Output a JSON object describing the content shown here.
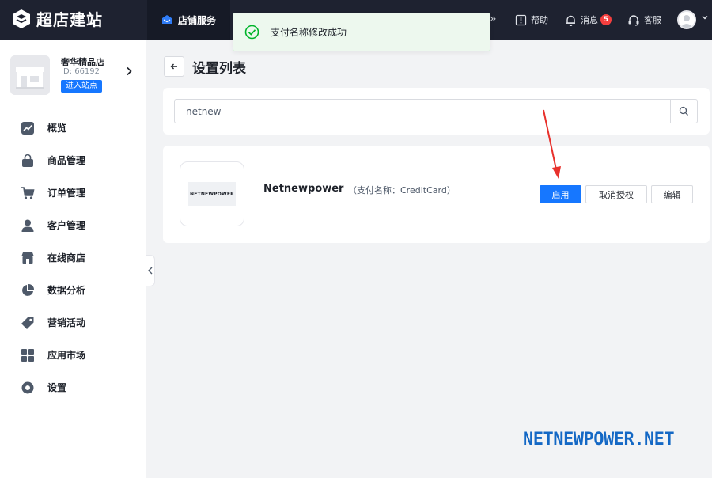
{
  "brand": {
    "name": "超店建站"
  },
  "topbar": {
    "active_label": "店铺服务",
    "more_glyph": "»",
    "help_label": "帮助",
    "messages_label": "消息",
    "messages_count": "5",
    "service_label": "客服"
  },
  "toast": {
    "message": "支付名称修改成功",
    "status_color": "#00b42a"
  },
  "store": {
    "name": "奢华精品店",
    "id_label": "ID: 66192",
    "enter_label": "进入站点"
  },
  "sidebar": {
    "items": [
      {
        "label": "概览",
        "icon": "chart-icon"
      },
      {
        "label": "商品管理",
        "icon": "bag-icon"
      },
      {
        "label": "订单管理",
        "icon": "cart-icon"
      },
      {
        "label": "客户管理",
        "icon": "user-icon"
      },
      {
        "label": "在线商店",
        "icon": "shop-icon"
      },
      {
        "label": "数据分析",
        "icon": "pie-chart-icon"
      },
      {
        "label": "营销活动",
        "icon": "tag-icon"
      },
      {
        "label": "应用市场",
        "icon": "grid-icon"
      },
      {
        "label": "设置",
        "icon": "settings-icon"
      }
    ]
  },
  "page": {
    "title": "设置列表"
  },
  "search": {
    "value": "netnew"
  },
  "payment_item": {
    "logo_text": "NETNEWPOWER",
    "name": "Netnewpower",
    "subtitle": "（支付名称：CreditCard）",
    "enable_label": "启用",
    "revoke_label": "取消授权",
    "edit_label": "编辑"
  },
  "watermark": "NETNEWPOWER.NET",
  "colors": {
    "topbar_bg": "#1e2230",
    "accent": "#1677ff",
    "annotation_arrow": "#e8312c",
    "watermark": "#1468c5"
  }
}
